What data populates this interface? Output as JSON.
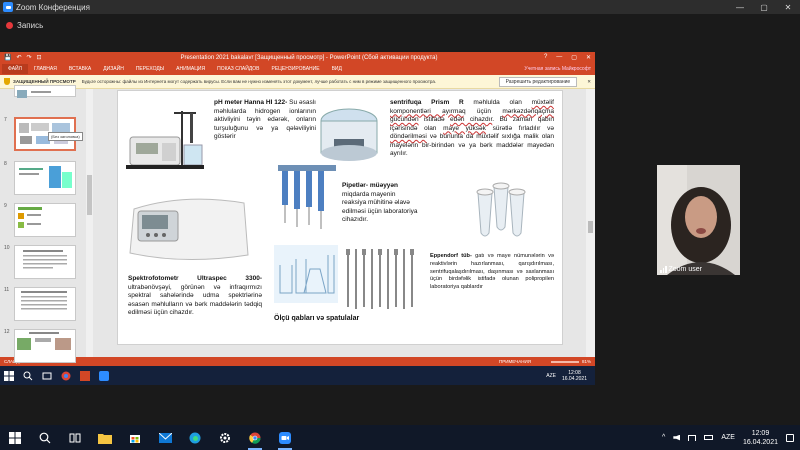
{
  "zoom": {
    "title": "Zoom Конференция",
    "recording": "Запись",
    "min": "—",
    "max": "▢",
    "close": "✕",
    "user_label": "Zoom user"
  },
  "powerpoint": {
    "title": "Presentation 2021 bakalavr [Защищенный просмотр] - PowerPoint (Сбой активации продукта)",
    "help": "?",
    "quick_access": [
      "💾",
      "↶",
      "↷",
      "⊡"
    ],
    "tabs": [
      "ФАЙЛ",
      "ГЛАВНАЯ",
      "ВСТАВКА",
      "ДИЗАЙН",
      "ПЕРЕХОДЫ",
      "АНИМАЦИЯ",
      "ПОКАЗ СЛАЙДОВ",
      "РЕЦЕНЗИРОВАНИЕ",
      "ВИД"
    ],
    "account": "Учетная запись Майкрософт",
    "protected_label": "ЗАЩИЩЕННЫЙ ПРОСМОТР",
    "protected_msg": "Будьте осторожны: файлы из Интернета могут содержать вирусы. Если вам не нужно изменять этот документ, лучше работать с ним в режиме защищенного просмотра.",
    "enable_edit": "Разрешить редактирование",
    "close_bar": "✕",
    "thumb_numbers": [
      "7",
      "8",
      "9",
      "10",
      "11",
      "12"
    ],
    "tooltip": "(Без заголовка)",
    "status_slide": "СЛАЙД 7 ИЗ 17",
    "status_lang": "РУССКИЙ",
    "status_notes": "ПРИМЕЧАНИЯ",
    "status_zoom": "81%",
    "inner_lang": "AZE",
    "inner_time": "12:08",
    "inner_date": "16.04.2021"
  },
  "slide": {
    "ph_title": "pH meter Hanna HI 122-",
    "ph_text": "Su əsaslı məhlularda hidrogen ionlarının aktivliyini təyin edərək, onların turşuluğunu və ya qələviliyini göstərir",
    "centrifuge_title": "sentrifuqa Prism R",
    "centrifuge_pre": "məhlulda olan",
    "centrifuge_u1": "müxtəlif komponentləri ayırmaq",
    "centrifuge_mid": "üçün",
    "centrifuge_u2": "mərkəzdənqaçma gücündən",
    "centrifuge_mid2": "istifadə",
    "centrifuge_u3": "edən cihazdır",
    "centrifuge_post": ". Bu zaman qabın içərisində olan",
    "centrifuge_u4": "maye yüksək",
    "centrifuge_post2": "sürətlə fırladılır və",
    "centrifuge_u5": "döndərilməsi",
    "centrifuge_post3": "və bununla da müxtəlif sıxlığa malik olan mayelərin bir-birindən və ya bərk maddələr mayedən ayrılır.",
    "pipette_title": "Pipetlər-",
    "pipette_title2": "müəyyən",
    "pipette_text": "miqdarda mayenin reaksiya mühitinə əlavə edilməsi üçün laboratoriya cihazıdır.",
    "spectro_title": "Spektrofotometr Ultraspec 3300-",
    "spectro_text": "ultrabənövşəyi, görünən və infraqırmızı spektral sahələrində udma spektrlərinə əsasən məhlulların və bərk maddələrin tədqiq edilməsi üçün cihazdır.",
    "eppendorf_title": "Eppendorf tüb-",
    "eppendorf_text": "gatı və maye nümunələrin və reaktivlərin hazırlanması, qarışdırılması, sentrifuqalaşdırılması, daşınması və saxlanması üçün birdəfəlik istifadə olunan polipropilen laboratoriya qablardır",
    "glass_title": "Ölçü qabları və spatulalar"
  },
  "taskbar": {
    "lang": "AZE",
    "time": "12:09",
    "date": "16.04.2021",
    "chevron": "^"
  },
  "colors": {
    "accent": "#d24726",
    "zoom_blue": "#2d8cff",
    "taskbar": "#101828"
  }
}
